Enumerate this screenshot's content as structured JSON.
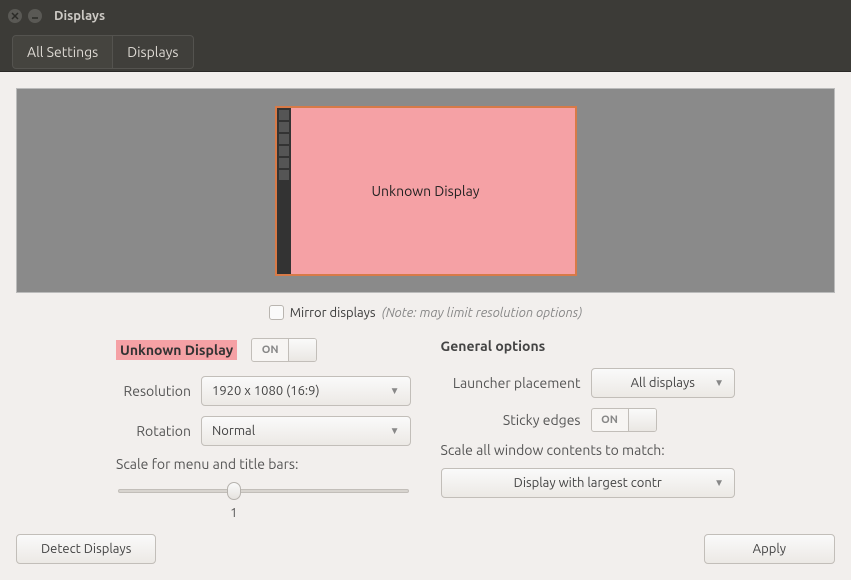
{
  "window": {
    "title": "Displays"
  },
  "breadcrumb": {
    "all_settings": "All Settings",
    "current": "Displays"
  },
  "preview": {
    "display_label": "Unknown Display"
  },
  "mirror": {
    "label": "Mirror displays",
    "note": "(Note: may limit resolution options)"
  },
  "display_settings": {
    "name": "Unknown Display",
    "toggle_state": "ON",
    "resolution_label": "Resolution",
    "resolution_value": "1920 x 1080 (16:9)",
    "rotation_label": "Rotation",
    "rotation_value": "Normal",
    "scale_label": "Scale for menu and title bars:",
    "scale_value": "1"
  },
  "general": {
    "title": "General options",
    "launcher_label": "Launcher placement",
    "launcher_value": "All displays",
    "sticky_label": "Sticky edges",
    "sticky_state": "ON",
    "scale_contents_label": "Scale all window contents to match:",
    "scale_contents_value": "Display with largest contr"
  },
  "footer": {
    "detect": "Detect Displays",
    "apply": "Apply"
  }
}
